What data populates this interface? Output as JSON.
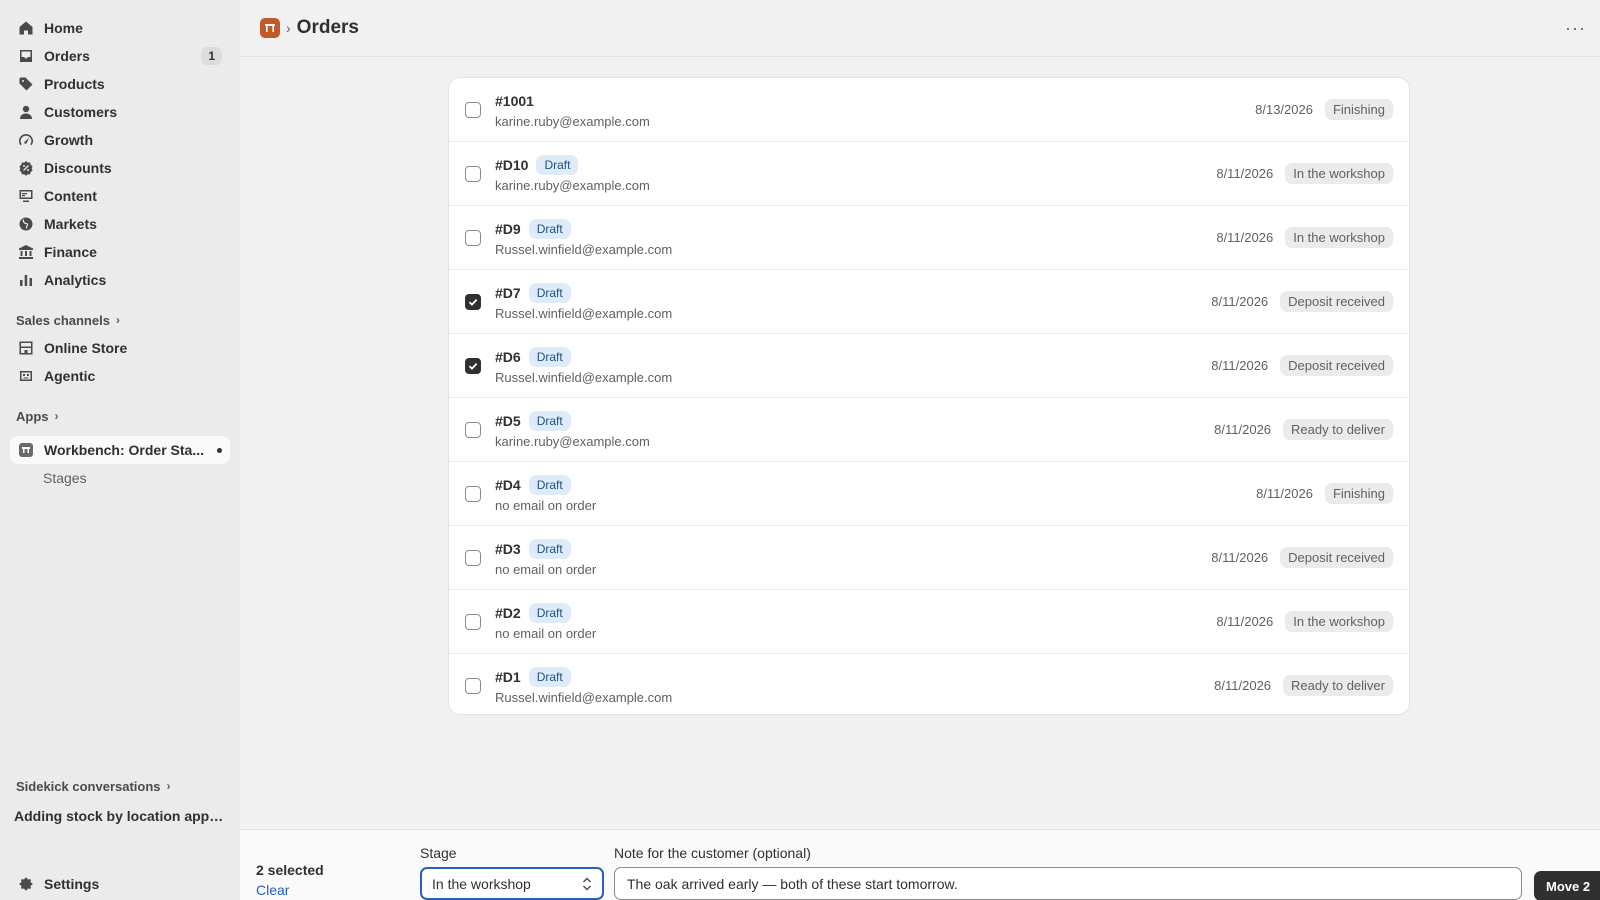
{
  "sidebar": {
    "nav": [
      {
        "label": "Home",
        "icon": "home-icon"
      },
      {
        "label": "Orders",
        "icon": "inbox-icon",
        "badge": "1"
      },
      {
        "label": "Products",
        "icon": "tag-icon"
      },
      {
        "label": "Customers",
        "icon": "person-icon"
      },
      {
        "label": "Growth",
        "icon": "gauge-icon"
      },
      {
        "label": "Discounts",
        "icon": "discount-icon"
      },
      {
        "label": "Content",
        "icon": "content-icon"
      },
      {
        "label": "Markets",
        "icon": "globe-icon"
      },
      {
        "label": "Finance",
        "icon": "bank-icon"
      },
      {
        "label": "Analytics",
        "icon": "bar-chart-icon"
      }
    ],
    "sales_channels_label": "Sales channels",
    "sales_channels": [
      {
        "label": "Online Store",
        "icon": "store-icon"
      },
      {
        "label": "Agentic",
        "icon": "robot-icon"
      }
    ],
    "apps_label": "Apps",
    "app": {
      "label": "Workbench: Order Sta...",
      "icon": "workbench-icon"
    },
    "app_sub": "Stages",
    "sidekick_label": "Sidekick conversations",
    "sidekick_conversation": "Adding stock by location app b...",
    "settings_label": "Settings"
  },
  "topbar": {
    "title": "Orders",
    "more": "···"
  },
  "orders": [
    {
      "id": "#1001",
      "draft": "",
      "email": "karine.ruby@example.com",
      "date": "8/13/2026",
      "stage": "Finishing",
      "checked": false
    },
    {
      "id": "#D10",
      "draft": "Draft",
      "email": "karine.ruby@example.com",
      "date": "8/11/2026",
      "stage": "In the workshop",
      "checked": false
    },
    {
      "id": "#D9",
      "draft": "Draft",
      "email": "Russel.winfield@example.com",
      "date": "8/11/2026",
      "stage": "In the workshop",
      "checked": false
    },
    {
      "id": "#D7",
      "draft": "Draft",
      "email": "Russel.winfield@example.com",
      "date": "8/11/2026",
      "stage": "Deposit received",
      "checked": true
    },
    {
      "id": "#D6",
      "draft": "Draft",
      "email": "Russel.winfield@example.com",
      "date": "8/11/2026",
      "stage": "Deposit received",
      "checked": true
    },
    {
      "id": "#D5",
      "draft": "Draft",
      "email": "karine.ruby@example.com",
      "date": "8/11/2026",
      "stage": "Ready to deliver",
      "checked": false
    },
    {
      "id": "#D4",
      "draft": "Draft",
      "email": "no email on order",
      "date": "8/11/2026",
      "stage": "Finishing",
      "checked": false
    },
    {
      "id": "#D3",
      "draft": "Draft",
      "email": "no email on order",
      "date": "8/11/2026",
      "stage": "Deposit received",
      "checked": false
    },
    {
      "id": "#D2",
      "draft": "Draft",
      "email": "no email on order",
      "date": "8/11/2026",
      "stage": "In the workshop",
      "checked": false
    },
    {
      "id": "#D1",
      "draft": "Draft",
      "email": "Russel.winfield@example.com",
      "date": "8/11/2026",
      "stage": "Ready to deliver",
      "checked": false
    }
  ],
  "bottombar": {
    "selected": "2 selected",
    "clear": "Clear",
    "stage_label": "Stage",
    "stage_value": "In the workshop",
    "note_label": "Note for the customer (optional)",
    "note_value": "The oak arrived early — both of these start tomorrow.",
    "move_button": "Move 2"
  },
  "colors": {
    "accent": "#2463bc",
    "app_logo": "#c05a2a",
    "draft_badge_bg": "#e0ebf8",
    "stage_badge_bg": "#ebebeb"
  }
}
